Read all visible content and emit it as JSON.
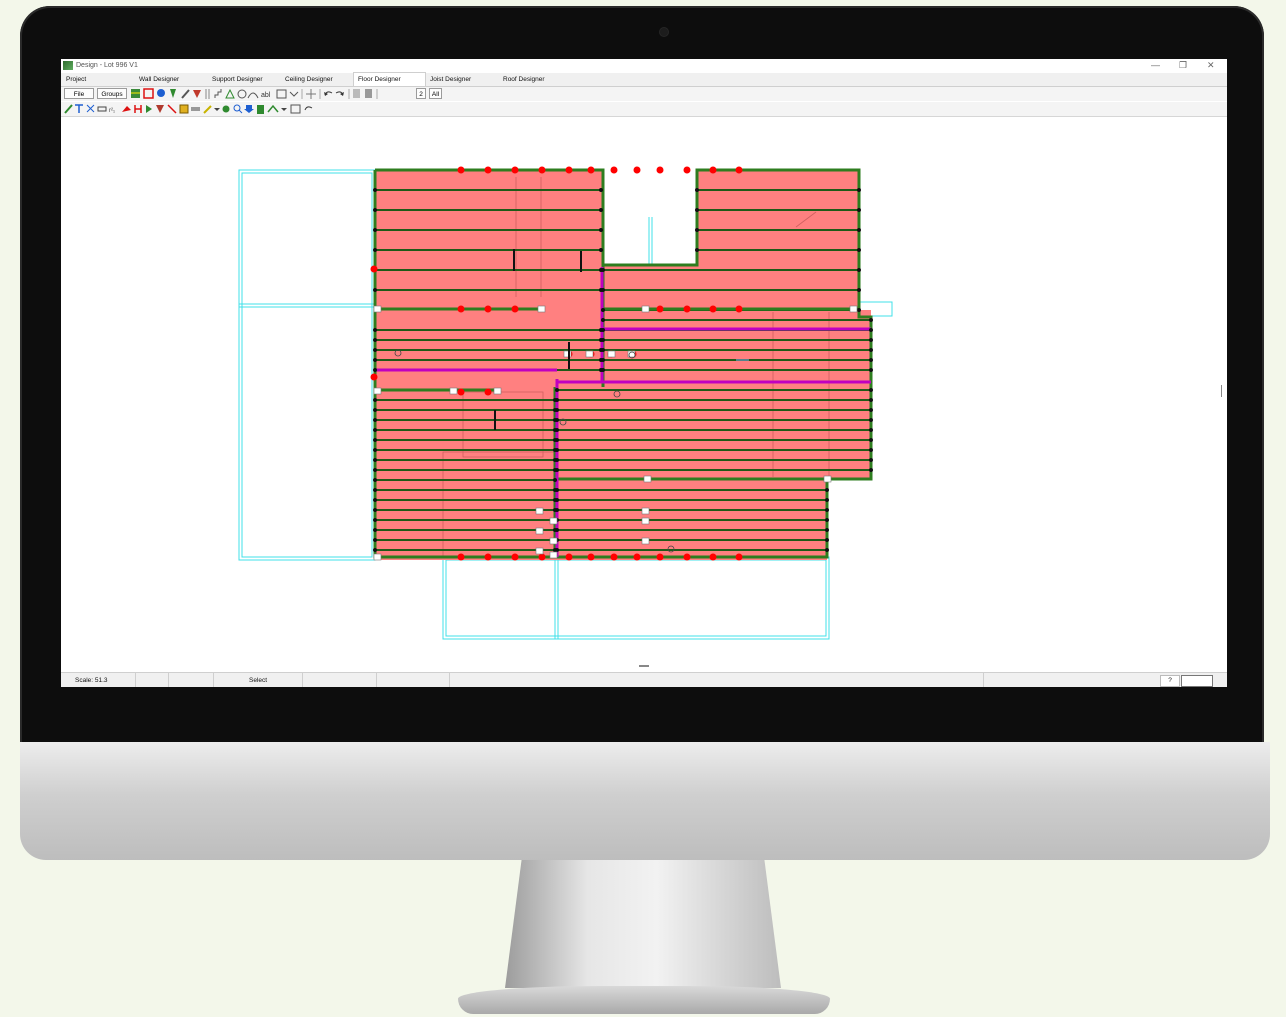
{
  "window": {
    "title": "Design - Lot 996 V1",
    "minimize": "—",
    "restore": "❐",
    "close": "✕"
  },
  "tabs": [
    {
      "label": "Project"
    },
    {
      "label": "Wall Designer"
    },
    {
      "label": "Support Designer"
    },
    {
      "label": "Ceiling Designer"
    },
    {
      "label": "Floor Designer",
      "active": true
    },
    {
      "label": "Joist Designer"
    },
    {
      "label": "Roof Designer"
    }
  ],
  "toolbar": {
    "file_label": "File",
    "groups_label": "Groups",
    "layer_number": "2",
    "all_label": "All",
    "text_tool": "abl"
  },
  "status": {
    "scale": "Scale: 51.3",
    "mode": "Select",
    "help": "?"
  },
  "colors": {
    "floor_fill": "#ff8080",
    "frame_green": "#2e7d1f",
    "beam_magenta": "#c000c0",
    "outline_cyan": "#40e0e8",
    "marker_red": "#ff0000"
  }
}
